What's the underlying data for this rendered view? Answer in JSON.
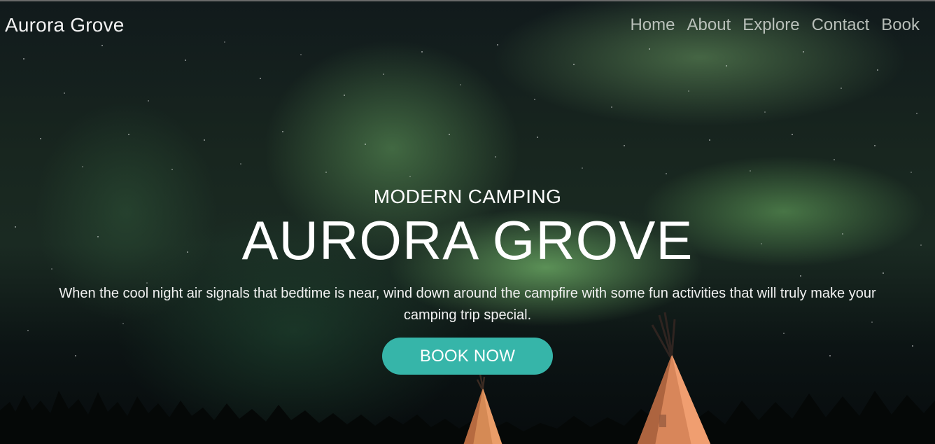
{
  "nav": {
    "brand": "Aurora Grove",
    "items": [
      {
        "label": "Home"
      },
      {
        "label": "About"
      },
      {
        "label": "Explore"
      },
      {
        "label": "Contact"
      },
      {
        "label": "Book"
      }
    ]
  },
  "hero": {
    "eyebrow": "MODERN CAMPING",
    "title": "AURORA GROVE",
    "description": "When the cool night air signals that bedtime is near, wind down around the campfire with some fun activities that will truly make your camping trip special.",
    "cta_label": "BOOK NOW"
  },
  "colors": {
    "accent": "#36b5a9",
    "text": "#ffffff"
  }
}
